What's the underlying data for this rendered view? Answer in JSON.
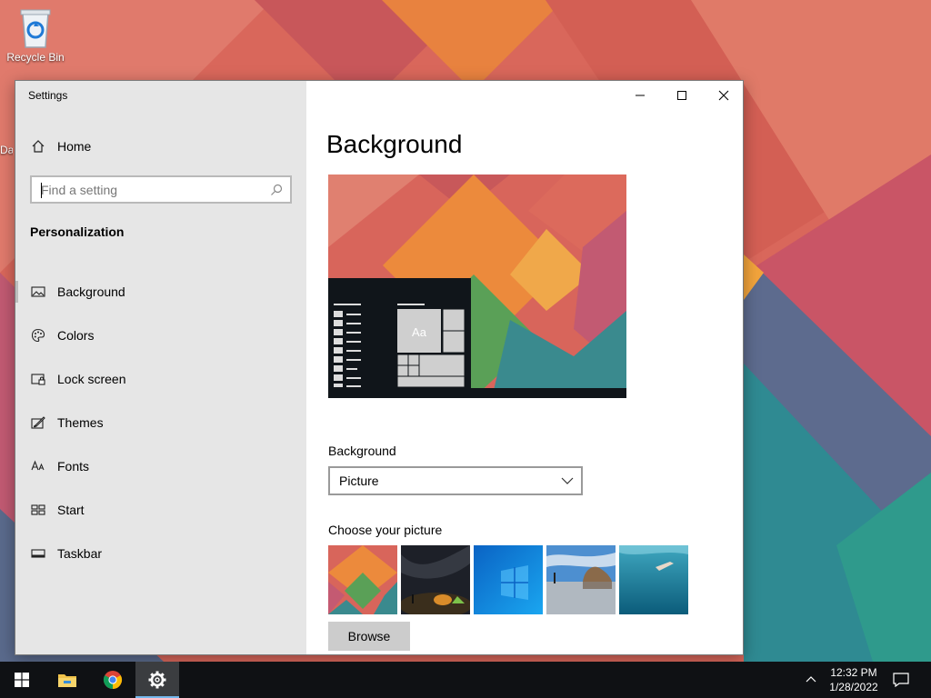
{
  "desktop": {
    "icons": [
      {
        "label": "Recycle Bin"
      },
      {
        "label": "Da"
      }
    ]
  },
  "window": {
    "title": "Settings",
    "controls": {
      "minimize": "minimize-icon",
      "maximize": "maximize-icon",
      "close": "close-icon"
    }
  },
  "nav": {
    "home_label": "Home",
    "search": {
      "placeholder": "Find a setting",
      "value": ""
    },
    "section_heading": "Personalization",
    "items": [
      {
        "label": "Background",
        "icon": "picture-icon",
        "selected": true
      },
      {
        "label": "Colors",
        "icon": "palette-icon",
        "selected": false
      },
      {
        "label": "Lock screen",
        "icon": "lock-screen-icon",
        "selected": false
      },
      {
        "label": "Themes",
        "icon": "brush-icon",
        "selected": false
      },
      {
        "label": "Fonts",
        "icon": "font-icon",
        "selected": false
      },
      {
        "label": "Start",
        "icon": "start-layout-icon",
        "selected": false
      },
      {
        "label": "Taskbar",
        "icon": "taskbar-icon",
        "selected": false
      }
    ]
  },
  "content": {
    "page_title": "Background",
    "preview": {
      "sample_text": "Aa"
    },
    "background_label": "Background",
    "background_select": {
      "value": "Picture"
    },
    "choose_label": "Choose your picture",
    "pictures": [
      "geometric-wallpaper",
      "night-sky-tent",
      "windows-blue",
      "beach-rocks",
      "underwater-swimmer"
    ],
    "browse_label": "Browse"
  },
  "taskbar": {
    "pinned": [
      "windows-start-icon",
      "file-explorer-icon",
      "chrome-icon",
      "settings-gear-icon"
    ],
    "active": "settings-gear-icon",
    "clock": {
      "time": "12:32 PM",
      "date": "1/28/2022"
    }
  },
  "colors": {
    "accent": "#0078d7",
    "nav_background": "#e6e6e6",
    "taskbar": "#0f1114"
  }
}
